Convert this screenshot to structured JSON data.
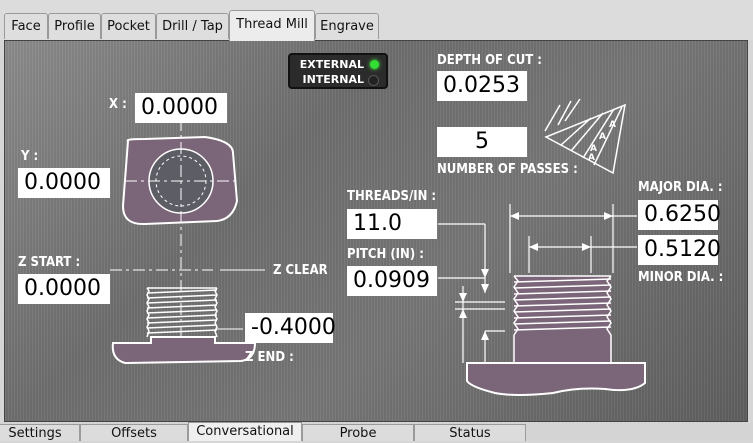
{
  "top_tabs": [
    "Face",
    "Profile",
    "Pocket",
    "Drill / Tap",
    "Thread Mill",
    "Engrave"
  ],
  "active_top_tab": "Thread Mill",
  "bottom_tabs": [
    "Settings",
    "Offsets",
    "Conversational",
    "Probe",
    "Status"
  ],
  "active_bottom_tab": "Conversational",
  "thread_type": {
    "external_label": "EXTERNAL",
    "internal_label": "INTERNAL",
    "external_led_color": "#22cc22",
    "internal_led_color": "#222222"
  },
  "fields": {
    "x_label": "X :",
    "x_value": "0.0000",
    "y_label": "Y :",
    "y_value": "0.0000",
    "z_start_label": "Z START :",
    "z_start_value": "0.0000",
    "z_clear_label": "Z CLEAR",
    "z_end_value": "-0.4000",
    "z_end_label": "Z END :",
    "depth_of_cut_label": "DEPTH OF CUT :",
    "depth_of_cut_value": "0.0253",
    "passes_value": "5",
    "passes_label": "NUMBER OF PASSES :",
    "threads_per_in_label": "THREADS/IN :",
    "threads_per_in_value": "11.0",
    "pitch_label": "PITCH (IN) :",
    "pitch_value": "0.0909",
    "major_dia_label": "MAJOR DIA. :",
    "major_dia_value": "0.6250",
    "minor_dia_value": "0.5120",
    "minor_dia_label": "MINOR DIA. :"
  },
  "triangle_letters": [
    "A",
    "A",
    "A",
    "A"
  ],
  "colors": {
    "part_fill": "#7b6578"
  }
}
